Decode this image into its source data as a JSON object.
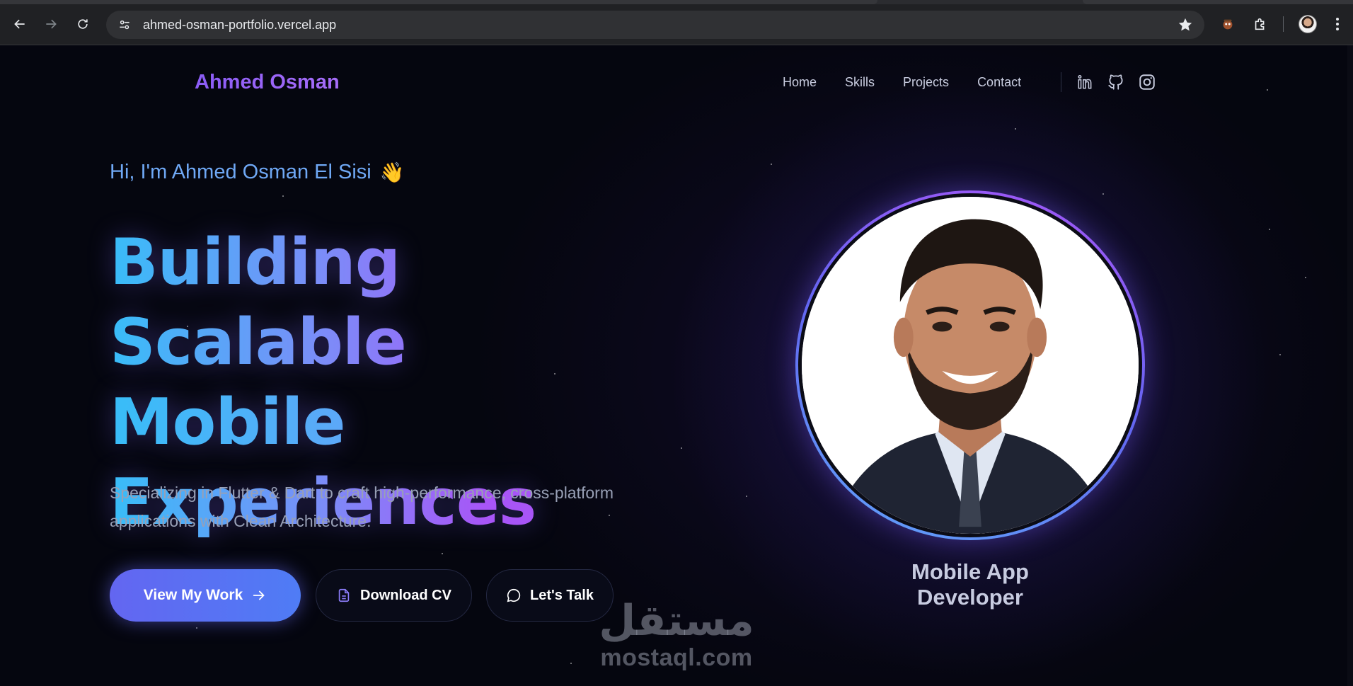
{
  "browser": {
    "url": "ahmed-osman-portfolio.vercel.app"
  },
  "site": {
    "logo": "Ahmed Osman",
    "nav": [
      "Home",
      "Skills",
      "Projects",
      "Contact"
    ]
  },
  "hero": {
    "greeting": "Hi, I'm Ahmed Osman El Sisi",
    "greeting_emoji": "👋",
    "headline": [
      "Building Scalable",
      "Mobile",
      "Experiences"
    ],
    "subtitle_line1": "Specializing in Flutter & Dart to craft high-performance, cross-platform",
    "subtitle_line2": "applications with Clean Architecture.",
    "buttons": {
      "primary": "View My Work",
      "cv": "Download CV",
      "talk": "Let's Talk"
    }
  },
  "profile": {
    "role": "Mobile App Developer"
  },
  "watermark": {
    "arabic": "مستقل",
    "latin": "mostaql.com"
  },
  "colors": {
    "accent_purple": "#a855f7",
    "accent_blue": "#38bdf8",
    "button_indigo": "#6366f1"
  },
  "icons": [
    "back-icon",
    "forward-icon",
    "reload-icon",
    "site-info-icon",
    "star-icon",
    "extension-icon",
    "puzzle-icon",
    "linkedin-icon",
    "github-icon",
    "instagram-icon",
    "arrow-right-icon",
    "document-icon",
    "chat-icon"
  ]
}
